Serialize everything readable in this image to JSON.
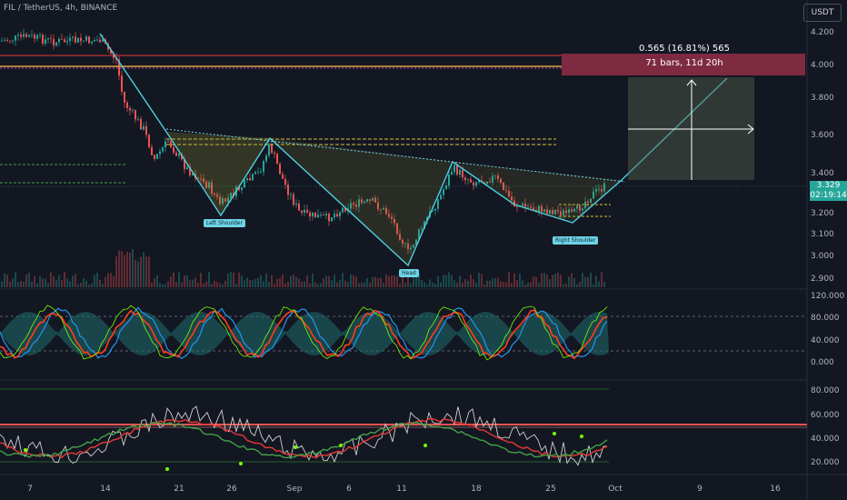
{
  "header": {
    "symbol": "FIL / TetherUS, 4h, BINANCE",
    "currency": "USDT"
  },
  "price_badge": {
    "price": "3.329",
    "countdown": "02:19:14"
  },
  "measure": {
    "change": "0.565 (16.81%) 565",
    "range": "71 bars, 11d 20h"
  },
  "pattern_labels": {
    "left_shoulder": "Left Shoulder",
    "head": "Head",
    "right_shoulder": "Right Shoulder"
  },
  "axes": {
    "x_ticks": [
      "7",
      "14",
      "21",
      "26",
      "Sep",
      "6",
      "11",
      "18",
      "25",
      "Oct",
      "9",
      "16"
    ],
    "price_ticks": [
      "4.200",
      "4.000",
      "3.800",
      "3.600",
      "3.400",
      "3.200",
      "3.100",
      "3.000",
      "2.900"
    ],
    "osc1_ticks": [
      "120.000",
      "80.000",
      "40.000",
      "0.000"
    ],
    "osc2_ticks": [
      "80.000",
      "60.000",
      "40.000",
      "20.000"
    ]
  },
  "colors": {
    "background": "#131722",
    "up": "#26a69a",
    "down": "#ef5350",
    "pattern": "#4dd0e1",
    "axis_text": "#b2b5be",
    "measure_box": "#8b2d46"
  }
}
